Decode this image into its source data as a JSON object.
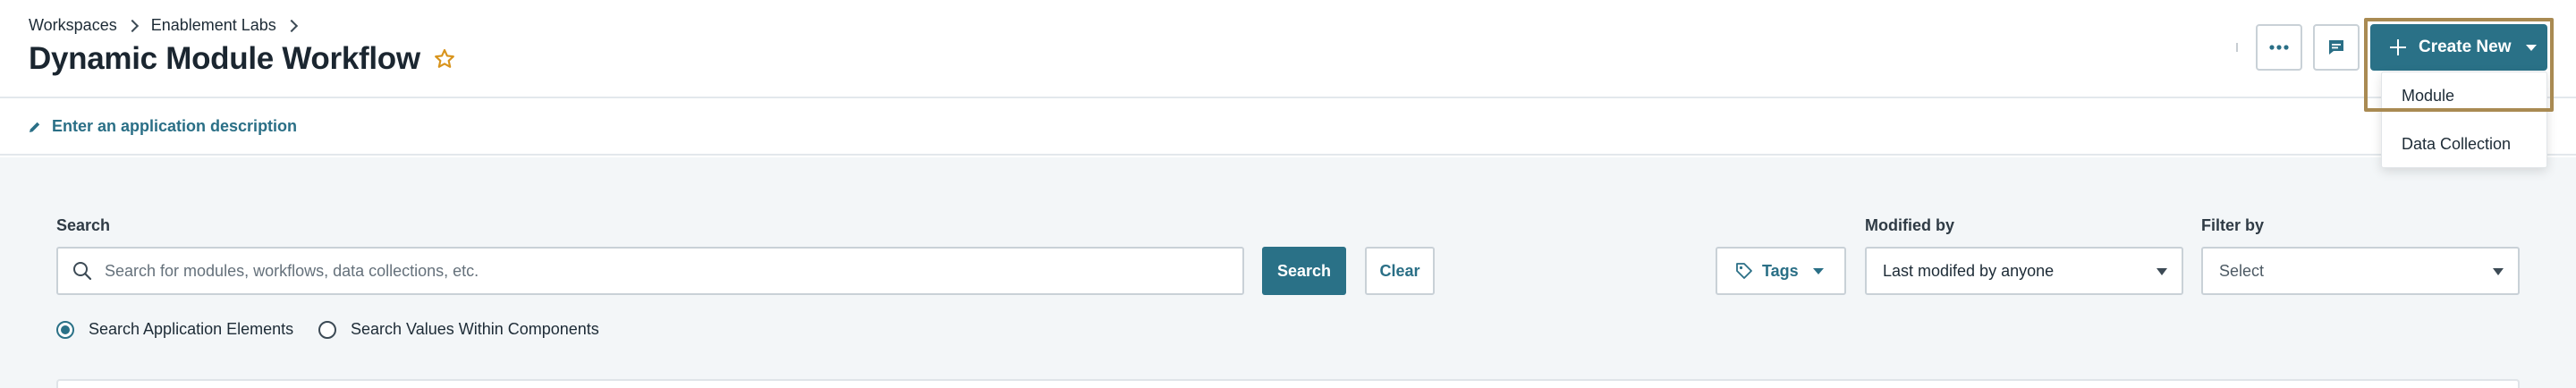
{
  "breadcrumb": {
    "items": [
      "Workspaces",
      "Enablement Labs"
    ]
  },
  "page": {
    "title": "Dynamic Module Workflow",
    "favorite_icon": "star-outline-icon"
  },
  "header_actions": {
    "more_icon": "more-horizontal-icon",
    "comment_icon": "comment-icon",
    "create_new": {
      "label": "Create New",
      "icon": "plus-icon",
      "caret_icon": "caret-down-icon"
    },
    "create_menu": [
      "Module",
      "Data Collection"
    ]
  },
  "description": {
    "link_label": "Enter an application description",
    "icon": "pencil-icon"
  },
  "search": {
    "label": "Search",
    "placeholder": "Search for modules, workflows, data collections, etc.",
    "value": "",
    "search_button": "Search",
    "clear_button": "Clear",
    "tags_button": "Tags"
  },
  "filters": {
    "modified_by": {
      "label": "Modified by",
      "value": "Last modifed by anyone"
    },
    "filter_by": {
      "label": "Filter by",
      "value": "Select"
    }
  },
  "search_scope": {
    "options": [
      "Search Application Elements",
      "Search Values Within Components"
    ],
    "selected": 0
  },
  "colors": {
    "primary": "#2a7187",
    "link": "#2a6f86",
    "favorite": "#d8941d",
    "highlight": "#a98a52",
    "background": "#f3f6f8"
  }
}
